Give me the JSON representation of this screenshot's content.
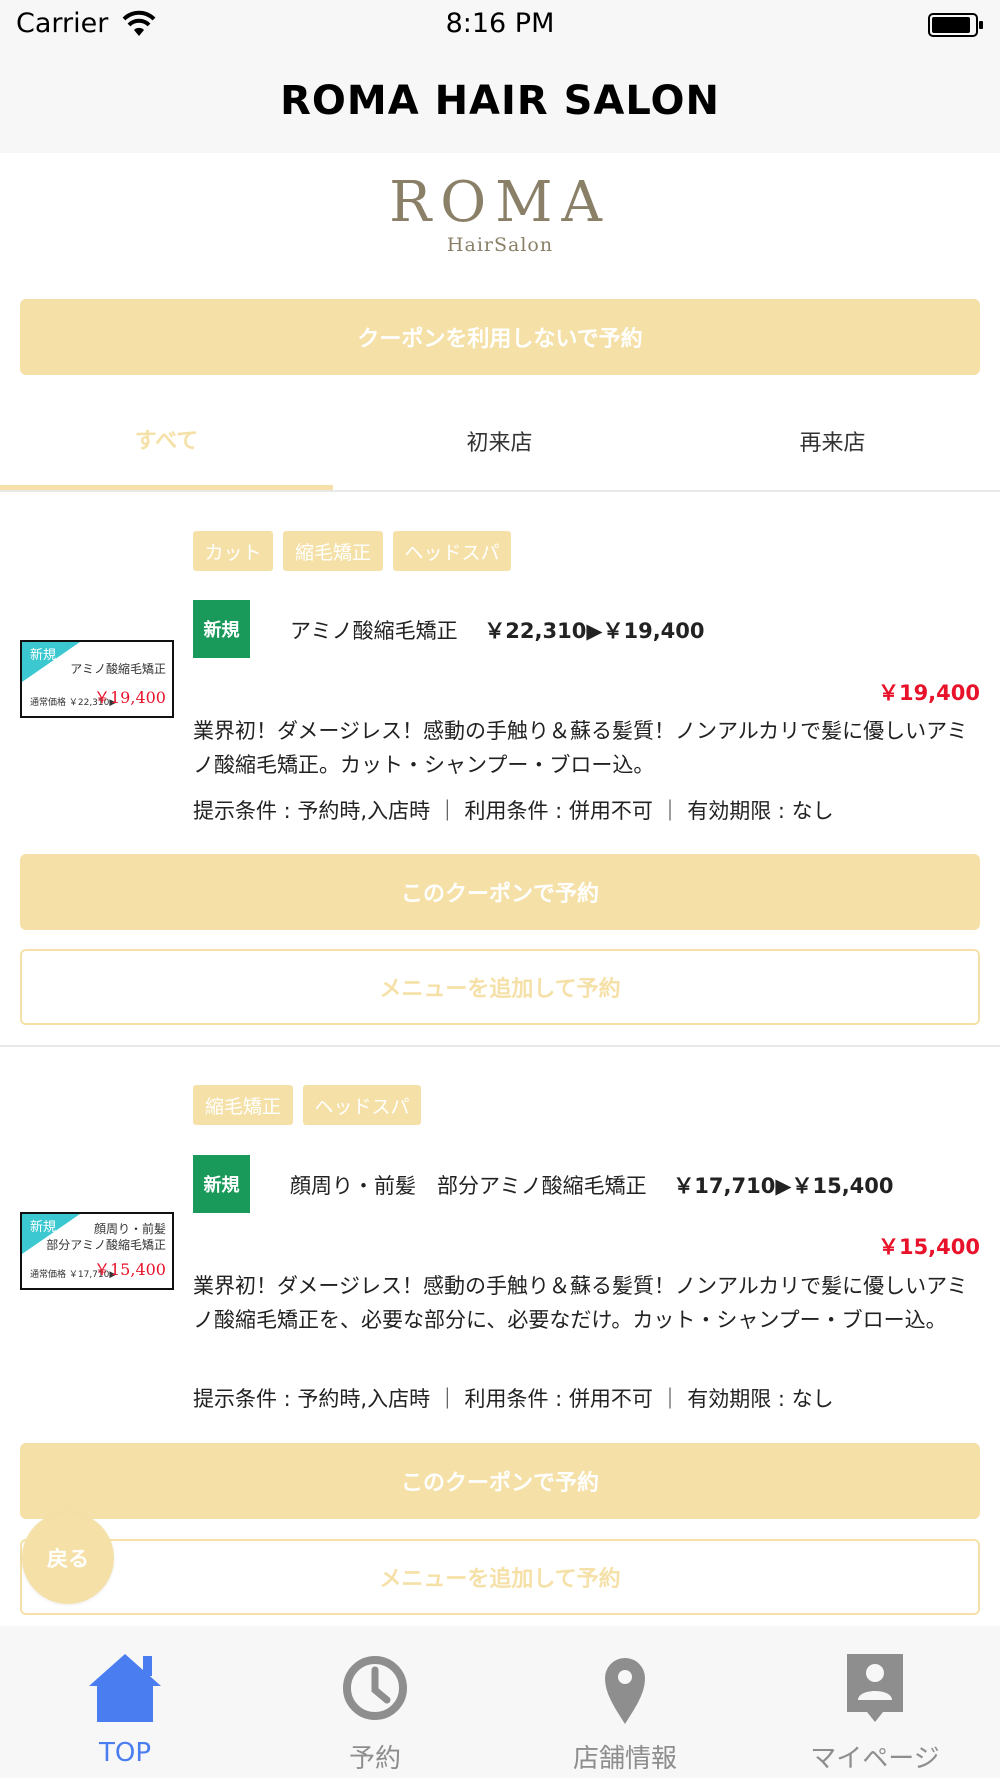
{
  "status_bar": {
    "carrier": "Carrier",
    "time": "8:16 PM"
  },
  "header": {
    "title": "ROMA HAIR SALON"
  },
  "logo": {
    "main": "ROMA",
    "sub": "HairSalon"
  },
  "no_coupon_button": "クーポンを利用しないで予約",
  "tabs": [
    {
      "label": "すべて",
      "active": true
    },
    {
      "label": "初来店",
      "active": false
    },
    {
      "label": "再来店",
      "active": false
    }
  ],
  "coupons": [
    {
      "tags": [
        "カット",
        "縮毛矯正",
        "ヘッドスパ"
      ],
      "badge": "新規",
      "title": "アミノ酸縮毛矯正",
      "price_change": "￥22,310▶￥19,400",
      "price": "￥19,400",
      "description": "業界初！ダメージレス！感動の手触り＆蘇る髪質！ノンアルカリで髪に優しいアミノ酸縮毛矯正。カット・シャンプー・ブロー込。",
      "conditions": "提示条件 : 予約時,入店時 ｜ 利用条件 : 併用不可 ｜ 有効期限 : なし",
      "thumb": {
        "new": "新規",
        "name_lines": [
          "アミノ酸縮毛矯正"
        ],
        "small": "通常価格 ￥22,310▶",
        "price": "￥19,400"
      },
      "reserve_button": "このクーポンで予約",
      "add_menu_button": "メニューを追加して予約"
    },
    {
      "tags": [
        "縮毛矯正",
        "ヘッドスパ"
      ],
      "badge": "新規",
      "title": "顔周り・前髪　部分アミノ酸縮毛矯正",
      "price_change": "￥17,710▶￥15,400",
      "price": "￥15,400",
      "description": "業界初！ダメージレス！感動の手触り＆蘇る髪質！ノンアルカリで髪に優しいアミノ酸縮毛矯正を、必要な部分に、必要なだけ。カット・シャンプー・ブロー込。",
      "conditions": "提示条件 : 予約時,入店時 ｜ 利用条件 : 併用不可 ｜ 有効期限 : なし",
      "thumb": {
        "new": "新規",
        "name_lines": [
          "顔周り・前髪",
          "部分アミノ酸縮毛矯正"
        ],
        "small": "通常価格 ￥17,710▶",
        "price": "￥15,400"
      },
      "reserve_button": "このクーポンで予約",
      "add_menu_button": "メニューを追加して予約"
    }
  ],
  "back_button": "戻る",
  "tab_bar": [
    {
      "label": "TOP",
      "icon": "home-icon",
      "active": true
    },
    {
      "label": "予約",
      "icon": "clock-icon",
      "active": false
    },
    {
      "label": "店舗情報",
      "icon": "location-pin-icon",
      "active": false
    },
    {
      "label": "マイページ",
      "icon": "profile-icon",
      "active": false
    }
  ],
  "colors": {
    "accent": "#f5e1a8",
    "price_red": "#e8122a",
    "new_badge": "#1a9a5a",
    "tab_active": "#4a7ef0"
  }
}
